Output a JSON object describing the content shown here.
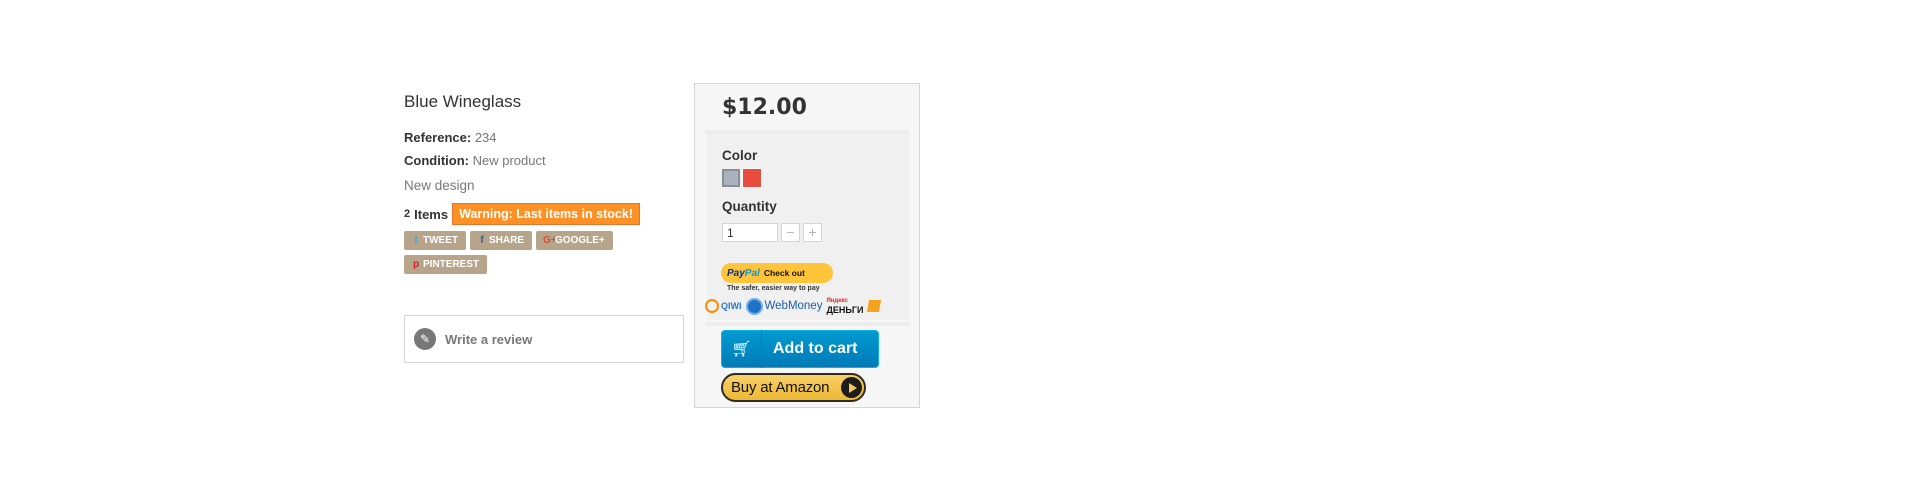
{
  "product": {
    "name": "Blue Wineglass",
    "reference_label": "Reference:",
    "reference_value": "234",
    "condition_label": "Condition:",
    "condition_value": "New product",
    "short_description": "New design",
    "quantity_count": "2",
    "quantity_unit": "Items",
    "stock_warning": "Warning: Last items in stock!"
  },
  "social": [
    {
      "icon": "twitter-icon",
      "glyph": "t",
      "label": "TWEET"
    },
    {
      "icon": "facebook-icon",
      "glyph": "f",
      "label": "SHARE"
    },
    {
      "icon": "google-plus-icon",
      "glyph": "G+",
      "label": "GOOGLE+"
    },
    {
      "icon": "pinterest-icon",
      "glyph": "p",
      "label": "PINTEREST"
    }
  ],
  "review": {
    "label": "Write a review",
    "icon": "pencil-icon"
  },
  "buybox": {
    "price": "$12.00",
    "color_label": "Color",
    "colors": [
      {
        "name": "grey",
        "hex": "#aab2bd",
        "selected": true
      },
      {
        "name": "red",
        "hex": "#e84c3d",
        "selected": false
      }
    ],
    "quantity_label": "Quantity",
    "quantity_value": "1",
    "minus_glyph": "−",
    "plus_glyph": "+",
    "paypal": {
      "logo_a": "Pay",
      "logo_b": "Pal",
      "action": "Check out",
      "tagline": "The safer, easier way to pay"
    },
    "payment_logos": {
      "qiwi": "QIWI",
      "webmoney": "WebMoney",
      "yandex_top": "Яндекс",
      "yandex_bottom": "ДЕНЬГИ"
    },
    "add_to_cart": "Add to cart",
    "buy_at_amazon": "Buy at Amazon"
  },
  "colors": {
    "warning_bg": "#fe9126",
    "social_bg": "#b7a58b",
    "cart_blue": "#0088c7",
    "amazon_yellow": "#f2c14a"
  }
}
